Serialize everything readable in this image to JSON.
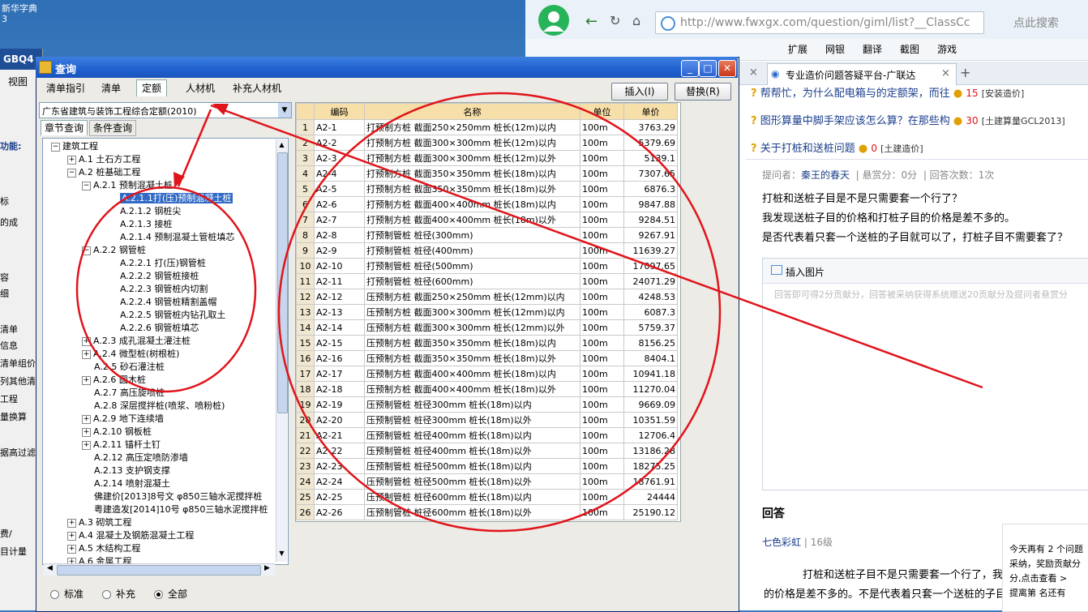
{
  "desktop": {
    "icon_label": "新华字典",
    "icon_sub": "3"
  },
  "bg_app": {
    "title": "GBQ4",
    "menu_view": "视图",
    "sidebar": [
      "功能:",
      "标",
      "的成",
      "容",
      "细",
      "清单",
      "信息",
      "清单组价",
      "列其他清",
      "工程",
      "量换算",
      "据高过滤",
      "目计量"
    ],
    "tab_label": "费/"
  },
  "browser": {
    "url": "http://www.fwxgx.com/question/giml/list?__ClassCc",
    "search_placeholder": "点此搜索",
    "fav_items": [
      "扩展",
      "网银",
      "翻译",
      "截图",
      "游戏"
    ],
    "tab_title": "专业造价问题答疑平台-广联达",
    "tab_close": "×",
    "tab_new": "+",
    "questions": [
      {
        "text": "帮帮忙，为什么配电箱与的定额架，而往",
        "score": "15",
        "tag": "[安装造价]"
      },
      {
        "text": "图形算量中脚手架应该怎么算？在那些构",
        "score": "30",
        "tag": "[土建算量GCL2013]"
      },
      {
        "text": "关于打桩和送桩问题",
        "score": "0",
        "tag": "[土建造价]"
      }
    ],
    "meta": {
      "asker_label": "提问者：",
      "asker": "秦王的春天",
      "reward": "悬赏分：0分",
      "answers": "回答次数：1次"
    },
    "question_body": [
      "打桩和送桩子目是不是只需要套一个行了？",
      "我发现送桩子目的价格和打桩子目的价格是差不多的。",
      "是否代表着只套一个送桩的子目就可以了，打桩子目不需要套了？"
    ],
    "insert_image": "插入图片",
    "answer_placeholder": "回答即可得2分贡献分，回答被采纳获得系统赠送20贡献分及提问者悬赏分",
    "answer_heading": "回答",
    "answerer": "七色彩虹",
    "answerer_level": "16级",
    "answer_body": [
      "打桩和送桩子目不是只需要套一个行了，我发现送桩子",
      "的价格是差不多的。不是代表着只套一个送桩的子目就可以了"
    ],
    "notice": [
      "今天再有 2 个问题",
      "采纳，奖励贡献分",
      "分,点击查看 >",
      "提离第 名还有"
    ]
  },
  "dialog": {
    "title": "查询",
    "tabs": [
      "清单指引",
      "清单",
      "定额",
      "人材机",
      "补充人材机"
    ],
    "active_tab": "定额",
    "insert_button": "插入(I)",
    "replace_button": "替换(R)",
    "quota_library": "广东省建筑与装饰工程综合定额(2010)",
    "subtabs": [
      "章节查询",
      "条件查询"
    ],
    "tree": [
      {
        "label": "建筑工程",
        "level": 0,
        "exp": "−"
      },
      {
        "label": "A.1 土石方工程",
        "level": 1,
        "exp": "+"
      },
      {
        "label": "A.2 桩基础工程",
        "level": 1,
        "exp": "−"
      },
      {
        "label": "A.2.1 预制混凝土桩",
        "level": 2,
        "exp": "−"
      },
      {
        "label": "A.2.1.1打(压)预制混凝土桩",
        "level": 3,
        "exp": "",
        "selected": true
      },
      {
        "label": "A.2.1.2 钢桩尖",
        "level": 3,
        "exp": ""
      },
      {
        "label": "A.2.1.3 接桩",
        "level": 3,
        "exp": ""
      },
      {
        "label": "A.2.1.4 预制混凝土管桩填芯",
        "level": 3,
        "exp": ""
      },
      {
        "label": "A.2.2 钢管桩",
        "level": 2,
        "exp": "−"
      },
      {
        "label": "A.2.2.1 打(压)钢管桩",
        "level": 3,
        "exp": ""
      },
      {
        "label": "A.2.2.2 钢管桩接桩",
        "level": 3,
        "exp": ""
      },
      {
        "label": "A.2.2.3 钢管桩内切割",
        "level": 3,
        "exp": ""
      },
      {
        "label": "A.2.2.4 钢管桩精割盖帽",
        "level": 3,
        "exp": ""
      },
      {
        "label": "A.2.2.5 钢管桩内钻孔取土",
        "level": 3,
        "exp": ""
      },
      {
        "label": "A.2.2.6 钢管桩填芯",
        "level": 3,
        "exp": ""
      },
      {
        "label": "A.2.3 成孔混凝土灌注桩",
        "level": 2,
        "exp": "+"
      },
      {
        "label": "A.2.4 微型桩(树根桩)",
        "level": 2,
        "exp": "+"
      },
      {
        "label": "A.2.5 砂石灌注桩",
        "level": 2,
        "exp": ""
      },
      {
        "label": "A.2.6 圆木桩",
        "level": 2,
        "exp": "+"
      },
      {
        "label": "A.2.7 高压旋喷桩",
        "level": 2,
        "exp": ""
      },
      {
        "label": "A.2.8 深层搅拌桩(喷浆、喷粉桩)",
        "level": 2,
        "exp": ""
      },
      {
        "label": "A.2.9 地下连续墙",
        "level": 2,
        "exp": "+"
      },
      {
        "label": "A.2.10 钢板桩",
        "level": 2,
        "exp": "+"
      },
      {
        "label": "A.2.11 锚杆土钉",
        "level": 2,
        "exp": "+"
      },
      {
        "label": "A.2.12 高压定喷防渗墙",
        "level": 2,
        "exp": ""
      },
      {
        "label": "A.2.13 支护钢支撑",
        "level": 2,
        "exp": ""
      },
      {
        "label": "A.2.14 喷射混凝土",
        "level": 2,
        "exp": ""
      },
      {
        "label": "佛建价[2013]8号文 φ850三轴水泥搅拌桩",
        "level": 2,
        "exp": ""
      },
      {
        "label": "粤建造发[2014]10号 φ850三轴水泥搅拌桩",
        "level": 2,
        "exp": ""
      },
      {
        "label": "A.3 砌筑工程",
        "level": 1,
        "exp": "+"
      },
      {
        "label": "A.4 混凝土及钢筋混凝土工程",
        "level": 1,
        "exp": "+"
      },
      {
        "label": "A.5 木结构工程",
        "level": 1,
        "exp": "+"
      },
      {
        "label": "A.6 金属工程",
        "level": 1,
        "exp": "+"
      }
    ],
    "radios": [
      {
        "label": "标准",
        "checked": false
      },
      {
        "label": "补充",
        "checked": false
      },
      {
        "label": "全部",
        "checked": true
      }
    ],
    "columns": [
      "编码",
      "名称",
      "单位",
      "单价"
    ],
    "rows": [
      [
        "1",
        "A2-1",
        "打预制方桩 截面250×250mm 桩长(12m)以内",
        "100m",
        "3763.29"
      ],
      [
        "2",
        "A2-2",
        "打预制方桩 截面300×300mm 桩长(12m)以内",
        "100m",
        "5379.69"
      ],
      [
        "3",
        "A2-3",
        "打预制方桩 截面300×300mm 桩长(12m)以外",
        "100m",
        "5139.1"
      ],
      [
        "4",
        "A2-4",
        "打预制方桩 截面350×350mm 桩长(18m)以内",
        "100m",
        "7307.65"
      ],
      [
        "5",
        "A2-5",
        "打预制方桩 截面350×350mm 桩长(18m)以外",
        "100m",
        "6876.3"
      ],
      [
        "6",
        "A2-6",
        "打预制方桩 截面400×400mm 桩长(18m)以内",
        "100m",
        "9847.88"
      ],
      [
        "7",
        "A2-7",
        "打预制方桩 截面400×400mm 桩长(18m)以外",
        "100m",
        "9284.51"
      ],
      [
        "8",
        "A2-8",
        "打预制管桩 桩径(300mm)",
        "100m",
        "9267.91"
      ],
      [
        "9",
        "A2-9",
        "打预制管桩 桩径(400mm)",
        "100m",
        "11639.27"
      ],
      [
        "10",
        "A2-10",
        "打预制管桩 桩径(500mm)",
        "100m",
        "17097.65"
      ],
      [
        "11",
        "A2-11",
        "打预制管桩 桩径(600mm)",
        "100m",
        "24071.29"
      ],
      [
        "12",
        "A2-12",
        "压预制方桩 截面250×250mm 桩长(12mm)以内",
        "100m",
        "4248.53"
      ],
      [
        "13",
        "A2-13",
        "压预制方桩 截面300×300mm 桩长(12mm)以内",
        "100m",
        "6087.3"
      ],
      [
        "14",
        "A2-14",
        "压预制方桩 截面300×300mm 桩长(12mm)以外",
        "100m",
        "5759.37"
      ],
      [
        "15",
        "A2-15",
        "压预制方桩 截面350×350mm 桩长(18m)以内",
        "100m",
        "8156.25"
      ],
      [
        "16",
        "A2-16",
        "压预制方桩 截面350×350mm 桩长(18m)以外",
        "100m",
        "8404.1"
      ],
      [
        "17",
        "A2-17",
        "压预制方桩 截面400×400mm 桩长(18m)以内",
        "100m",
        "10941.18"
      ],
      [
        "18",
        "A2-18",
        "压预制方桩 截面400×400mm 桩长(18m)以外",
        "100m",
        "11270.04"
      ],
      [
        "19",
        "A2-19",
        "压预制管桩 桩径300mm 桩长(18m)以内",
        "100m",
        "9669.09"
      ],
      [
        "20",
        "A2-20",
        "压预制管桩 桩径300mm 桩长(18m)以外",
        "100m",
        "10351.59"
      ],
      [
        "21",
        "A2-21",
        "压预制管桩 桩径400mm 桩长(18m)以内",
        "100m",
        "12706.4"
      ],
      [
        "22",
        "A2-22",
        "压预制管桩 桩径400mm 桩长(18m)以外",
        "100m",
        "13186.28"
      ],
      [
        "23",
        "A2-23",
        "压预制管桩 桩径500mm 桩长(18m)以内",
        "100m",
        "18275.25"
      ],
      [
        "24",
        "A2-24",
        "压预制管桩 桩径500mm 桩长(18m)以外",
        "100m",
        "18761.91"
      ],
      [
        "25",
        "A2-25",
        "压预制管桩 桩径600mm 桩长(18m)以内",
        "100m",
        "24444"
      ],
      [
        "26",
        "A2-26",
        "压预制管桩 桩径600mm 桩长(18m)以外",
        "100m",
        "25190.12"
      ]
    ]
  },
  "colors": {
    "annotation": "#e0141b",
    "title_bar": "#1f5fcf",
    "header": "#f6dfa8",
    "link": "#1a3e8c"
  }
}
